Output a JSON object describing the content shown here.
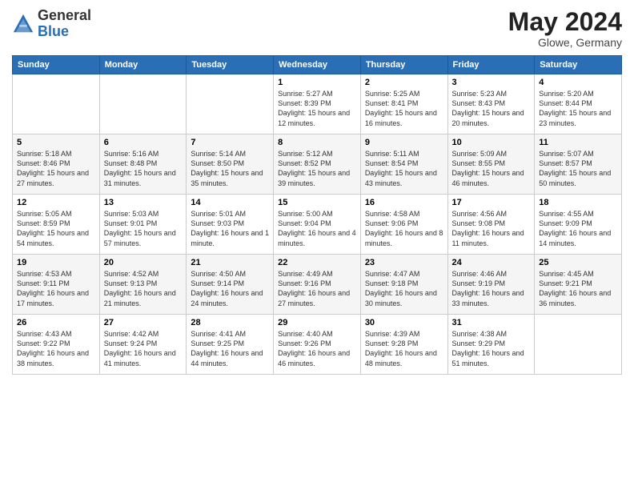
{
  "header": {
    "logo_general": "General",
    "logo_blue": "Blue",
    "title": "May 2024",
    "location": "Glowe, Germany"
  },
  "days_of_week": [
    "Sunday",
    "Monday",
    "Tuesday",
    "Wednesday",
    "Thursday",
    "Friday",
    "Saturday"
  ],
  "weeks": [
    [
      {
        "day": "",
        "sunrise": "",
        "sunset": "",
        "daylight": ""
      },
      {
        "day": "",
        "sunrise": "",
        "sunset": "",
        "daylight": ""
      },
      {
        "day": "",
        "sunrise": "",
        "sunset": "",
        "daylight": ""
      },
      {
        "day": "1",
        "sunrise": "Sunrise: 5:27 AM",
        "sunset": "Sunset: 8:39 PM",
        "daylight": "Daylight: 15 hours and 12 minutes."
      },
      {
        "day": "2",
        "sunrise": "Sunrise: 5:25 AM",
        "sunset": "Sunset: 8:41 PM",
        "daylight": "Daylight: 15 hours and 16 minutes."
      },
      {
        "day": "3",
        "sunrise": "Sunrise: 5:23 AM",
        "sunset": "Sunset: 8:43 PM",
        "daylight": "Daylight: 15 hours and 20 minutes."
      },
      {
        "day": "4",
        "sunrise": "Sunrise: 5:20 AM",
        "sunset": "Sunset: 8:44 PM",
        "daylight": "Daylight: 15 hours and 23 minutes."
      }
    ],
    [
      {
        "day": "5",
        "sunrise": "Sunrise: 5:18 AM",
        "sunset": "Sunset: 8:46 PM",
        "daylight": "Daylight: 15 hours and 27 minutes."
      },
      {
        "day": "6",
        "sunrise": "Sunrise: 5:16 AM",
        "sunset": "Sunset: 8:48 PM",
        "daylight": "Daylight: 15 hours and 31 minutes."
      },
      {
        "day": "7",
        "sunrise": "Sunrise: 5:14 AM",
        "sunset": "Sunset: 8:50 PM",
        "daylight": "Daylight: 15 hours and 35 minutes."
      },
      {
        "day": "8",
        "sunrise": "Sunrise: 5:12 AM",
        "sunset": "Sunset: 8:52 PM",
        "daylight": "Daylight: 15 hours and 39 minutes."
      },
      {
        "day": "9",
        "sunrise": "Sunrise: 5:11 AM",
        "sunset": "Sunset: 8:54 PM",
        "daylight": "Daylight: 15 hours and 43 minutes."
      },
      {
        "day": "10",
        "sunrise": "Sunrise: 5:09 AM",
        "sunset": "Sunset: 8:55 PM",
        "daylight": "Daylight: 15 hours and 46 minutes."
      },
      {
        "day": "11",
        "sunrise": "Sunrise: 5:07 AM",
        "sunset": "Sunset: 8:57 PM",
        "daylight": "Daylight: 15 hours and 50 minutes."
      }
    ],
    [
      {
        "day": "12",
        "sunrise": "Sunrise: 5:05 AM",
        "sunset": "Sunset: 8:59 PM",
        "daylight": "Daylight: 15 hours and 54 minutes."
      },
      {
        "day": "13",
        "sunrise": "Sunrise: 5:03 AM",
        "sunset": "Sunset: 9:01 PM",
        "daylight": "Daylight: 15 hours and 57 minutes."
      },
      {
        "day": "14",
        "sunrise": "Sunrise: 5:01 AM",
        "sunset": "Sunset: 9:03 PM",
        "daylight": "Daylight: 16 hours and 1 minute."
      },
      {
        "day": "15",
        "sunrise": "Sunrise: 5:00 AM",
        "sunset": "Sunset: 9:04 PM",
        "daylight": "Daylight: 16 hours and 4 minutes."
      },
      {
        "day": "16",
        "sunrise": "Sunrise: 4:58 AM",
        "sunset": "Sunset: 9:06 PM",
        "daylight": "Daylight: 16 hours and 8 minutes."
      },
      {
        "day": "17",
        "sunrise": "Sunrise: 4:56 AM",
        "sunset": "Sunset: 9:08 PM",
        "daylight": "Daylight: 16 hours and 11 minutes."
      },
      {
        "day": "18",
        "sunrise": "Sunrise: 4:55 AM",
        "sunset": "Sunset: 9:09 PM",
        "daylight": "Daylight: 16 hours and 14 minutes."
      }
    ],
    [
      {
        "day": "19",
        "sunrise": "Sunrise: 4:53 AM",
        "sunset": "Sunset: 9:11 PM",
        "daylight": "Daylight: 16 hours and 17 minutes."
      },
      {
        "day": "20",
        "sunrise": "Sunrise: 4:52 AM",
        "sunset": "Sunset: 9:13 PM",
        "daylight": "Daylight: 16 hours and 21 minutes."
      },
      {
        "day": "21",
        "sunrise": "Sunrise: 4:50 AM",
        "sunset": "Sunset: 9:14 PM",
        "daylight": "Daylight: 16 hours and 24 minutes."
      },
      {
        "day": "22",
        "sunrise": "Sunrise: 4:49 AM",
        "sunset": "Sunset: 9:16 PM",
        "daylight": "Daylight: 16 hours and 27 minutes."
      },
      {
        "day": "23",
        "sunrise": "Sunrise: 4:47 AM",
        "sunset": "Sunset: 9:18 PM",
        "daylight": "Daylight: 16 hours and 30 minutes."
      },
      {
        "day": "24",
        "sunrise": "Sunrise: 4:46 AM",
        "sunset": "Sunset: 9:19 PM",
        "daylight": "Daylight: 16 hours and 33 minutes."
      },
      {
        "day": "25",
        "sunrise": "Sunrise: 4:45 AM",
        "sunset": "Sunset: 9:21 PM",
        "daylight": "Daylight: 16 hours and 36 minutes."
      }
    ],
    [
      {
        "day": "26",
        "sunrise": "Sunrise: 4:43 AM",
        "sunset": "Sunset: 9:22 PM",
        "daylight": "Daylight: 16 hours and 38 minutes."
      },
      {
        "day": "27",
        "sunrise": "Sunrise: 4:42 AM",
        "sunset": "Sunset: 9:24 PM",
        "daylight": "Daylight: 16 hours and 41 minutes."
      },
      {
        "day": "28",
        "sunrise": "Sunrise: 4:41 AM",
        "sunset": "Sunset: 9:25 PM",
        "daylight": "Daylight: 16 hours and 44 minutes."
      },
      {
        "day": "29",
        "sunrise": "Sunrise: 4:40 AM",
        "sunset": "Sunset: 9:26 PM",
        "daylight": "Daylight: 16 hours and 46 minutes."
      },
      {
        "day": "30",
        "sunrise": "Sunrise: 4:39 AM",
        "sunset": "Sunset: 9:28 PM",
        "daylight": "Daylight: 16 hours and 48 minutes."
      },
      {
        "day": "31",
        "sunrise": "Sunrise: 4:38 AM",
        "sunset": "Sunset: 9:29 PM",
        "daylight": "Daylight: 16 hours and 51 minutes."
      },
      {
        "day": "",
        "sunrise": "",
        "sunset": "",
        "daylight": ""
      }
    ]
  ]
}
